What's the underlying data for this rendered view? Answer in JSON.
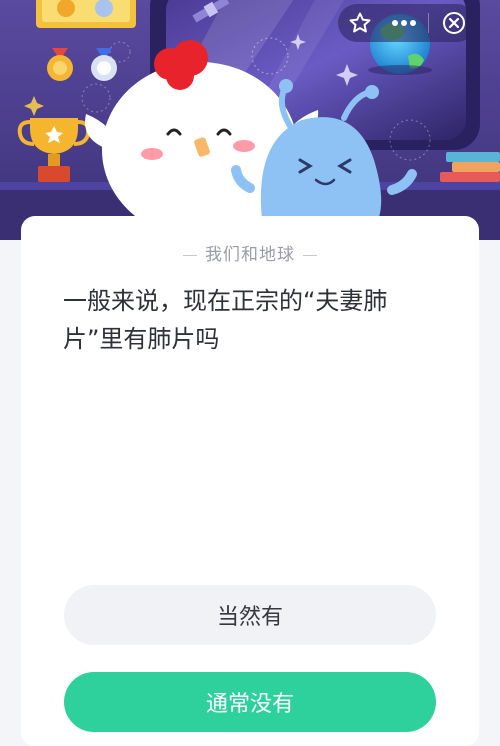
{
  "quiz": {
    "category": "我们和地球",
    "question": "一般来说，现在正宗的“夫妻肺片”里有肺片吗",
    "options": [
      {
        "label": "当然有"
      },
      {
        "label": "通常没有"
      }
    ]
  },
  "toolbar": {
    "icons": [
      "star-icon",
      "more-icon",
      "close-icon"
    ]
  },
  "colors": {
    "hero_bg": "#4a3c8a",
    "accent_green": "#2ed09c",
    "option_bg": "#f1f2f5"
  }
}
